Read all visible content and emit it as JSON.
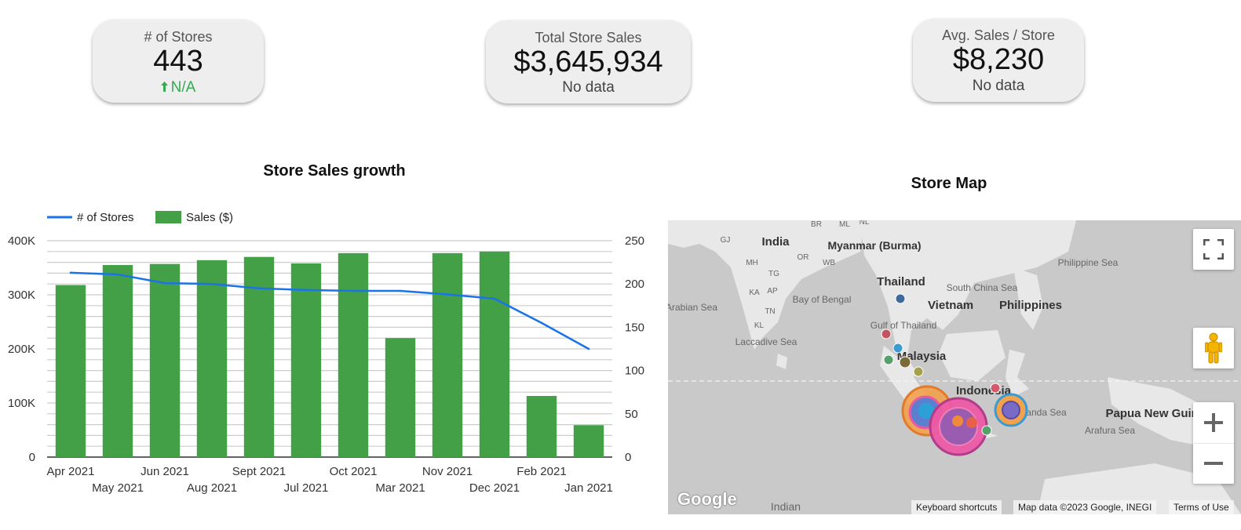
{
  "kpis": {
    "stores": {
      "label": "# of Stores",
      "value": "443",
      "sub": "N/A"
    },
    "sales": {
      "label": "Total Store Sales",
      "value": "$3,645,934",
      "sub": "No data"
    },
    "avg": {
      "label": "Avg. Sales / Store",
      "value": "$8,230",
      "sub": "No data"
    }
  },
  "sales_chart_title": "Store Sales growth",
  "map_title": "Store Map",
  "colors": {
    "bar": "#43a047",
    "line": "#1a73e8",
    "grid": "#cccccc",
    "up": "#34a853"
  },
  "chart_data": {
    "type": "bar",
    "title": "Store Sales growth",
    "categories": [
      "Apr 2021",
      "May 2021",
      "Jun 2021",
      "Aug 2021",
      "Sept 2021",
      "Jul 2021",
      "Oct 2021",
      "Mar 2021",
      "Nov 2021",
      "Dec 2021",
      "Feb 2021",
      "Jan 2021"
    ],
    "series": [
      {
        "name": "# of Stores",
        "type": "line",
        "axis": "right",
        "values": [
          213,
          211,
          201,
          200,
          195,
          193,
          192,
          192,
          188,
          183,
          155,
          125
        ]
      },
      {
        "name": "Sales ($)",
        "type": "bar",
        "axis": "left",
        "values": [
          318000,
          355000,
          357000,
          364000,
          370000,
          358000,
          377000,
          220000,
          377000,
          380000,
          113000,
          59000
        ]
      }
    ],
    "ylim_left": [
      0,
      400000
    ],
    "ylim_right": [
      0,
      250
    ],
    "yticks_left": [
      "0",
      "100K",
      "200K",
      "300K",
      "400K"
    ],
    "yticks_right": [
      "0",
      "50",
      "100",
      "150",
      "200",
      "250"
    ],
    "legend": "top-left",
    "grid": true
  },
  "map": {
    "region_labels": [
      "India",
      "Myanmar (Burma)",
      "Thailand",
      "Vietnam",
      "Philippines",
      "Malaysia",
      "Indonesia",
      "Papua New Guinea",
      "Bay of Bengal",
      "Arabian Sea",
      "Laccadive Sea",
      "South China Sea",
      "Philippine Sea",
      "Gulf of Thailand",
      "Banda Sea",
      "Arafura Sea",
      "Indian"
    ],
    "small_labels": [
      "GJ",
      "MH",
      "TG",
      "KA",
      "AP",
      "TN",
      "KL",
      "OR",
      "WB",
      "BR",
      "ML",
      "NL"
    ],
    "attribution": {
      "shortcuts": "Keyboard shortcuts",
      "data": "Map data ©2023 Google, INEGI",
      "terms": "Terms of Use"
    },
    "logo": "Google",
    "icons": [
      "fullscreen-icon",
      "pegman-icon",
      "zoom-in-icon",
      "zoom-out-icon"
    ]
  }
}
